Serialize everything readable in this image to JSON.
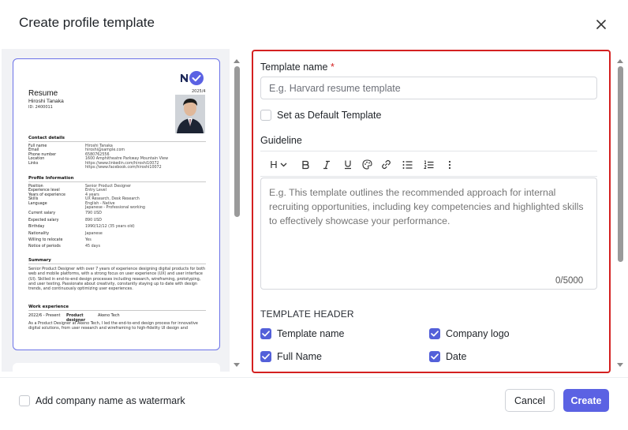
{
  "dialog": {
    "title": "Create profile template"
  },
  "preview": {
    "heading": "Resume",
    "name": "Hiroshi Tanaka",
    "id_line": "ID: 2400011",
    "date": "2025/4",
    "contact_title": "Contact details",
    "contact": [
      {
        "k": "Full name",
        "v": "Hiroshi Tanaka"
      },
      {
        "k": "Email",
        "v": "hiroshi@sample.com"
      },
      {
        "k": "Phone number",
        "v": "6580762556"
      },
      {
        "k": "Location",
        "v": "1600 Amphitheatre Parkway Mountain View"
      },
      {
        "k": "Links",
        "v": "https://www.linkedin.com/hiroshi10072"
      },
      {
        "k": "",
        "v": "https://www.facebook.com/hiroshi10072"
      }
    ],
    "profile_title": "Profile Information",
    "profile": [
      {
        "k": "Position",
        "v": "Senior Product Designer"
      },
      {
        "k": "Experience level",
        "v": "Entry Level"
      },
      {
        "k": "Years of experience",
        "v": "4 years"
      },
      {
        "k": "Skills",
        "v": "UX Research, Desk Research"
      },
      {
        "k": "Language",
        "v": "English - Native"
      },
      {
        "k": "",
        "v": "Japanese - Professional working"
      },
      {
        "k": "Current salary",
        "v": "790 USD"
      },
      {
        "k": "Expected salary",
        "v": "890 USD"
      },
      {
        "k": "Birthday",
        "v": "1990/12/12 (35 years old)"
      },
      {
        "k": "Nationality",
        "v": "Japanese"
      },
      {
        "k": "Willing to relocate",
        "v": "Yes"
      },
      {
        "k": "Notice of periods",
        "v": "45 days"
      }
    ],
    "summary_title": "Summary",
    "summary_text": "Senior Product Designer with over 7 years of experience designing digital products for both web and mobile platforms, with a strong focus on user experience (UX) and user interface (UI). Skilled in end-to-end design processes including research, wireframing, prototyping, and user testing. Passionate about creativity, constantly staying up to date with design trends, and continuously optimizing user experiences.",
    "work_title": "Work experience",
    "work_period": "2022/6 - Present",
    "work_role": "Product designer",
    "work_company": "Akeno Tech",
    "work_text": "As a Product Designer at Akeno Tech, I led the end-to-end design process for innovative digital solutions, from user research and wireframing to high-fidelity UI design and"
  },
  "form": {
    "template_name_label": "Template name",
    "required_mark": "*",
    "template_name_placeholder": "E.g. Harvard resume template",
    "default_label": "Set as Default Template",
    "guideline_label": "Guideline",
    "heading_button": "H",
    "guideline_placeholder": "E.g. This template outlines the recommended approach for internal recruiting opportunities, including key competencies and highlighted skills to effectively showcase your performance.",
    "counter": "0/5000",
    "header_section_title": "TEMPLATE HEADER",
    "header_options": [
      {
        "label": "Template name",
        "checked": true
      },
      {
        "label": "Company logo",
        "checked": true
      },
      {
        "label": "Full Name",
        "checked": true
      },
      {
        "label": "Date",
        "checked": true
      }
    ]
  },
  "footer": {
    "watermark_label": "Add company name as watermark",
    "cancel_label": "Cancel",
    "create_label": "Create"
  },
  "colors": {
    "accent": "#5b62e3",
    "highlight_border": "#d42020"
  }
}
